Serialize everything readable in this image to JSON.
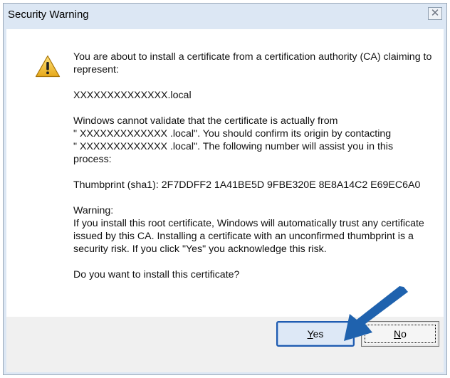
{
  "window": {
    "title": "Security Warning",
    "close_icon": "close-icon",
    "colors": {
      "titlebar": "#dce7f4",
      "content": "#ffffff",
      "footer": "#f0f0f0",
      "arrow": "#1f62ae"
    }
  },
  "message": {
    "icon": "warning-triangle-icon",
    "intro": "You are about to install a certificate from a certification authority (CA) claiming to represent:",
    "subject": "XXXXXXXXXXXXXX.local",
    "validation_line1": "Windows cannot validate that the certificate is actually from",
    "validation_line2": "\" XXXXXXXXXXXXX .local\". You should confirm its origin by contacting",
    "validation_line3": "\" XXXXXXXXXXXXX .local\". The following number will assist you in this",
    "validation_line4": "process:",
    "thumbprint": "Thumbprint (sha1): 2F7DDFF2 1A41BE5D 9FBE320E 8E8A14C2 E69EC6A0",
    "warning_heading": "Warning:",
    "warning_body": "If you install this root certificate, Windows will automatically trust any certificate issued by this CA. Installing a certificate with an unconfirmed thumbprint is a security risk. If you click \"Yes\" you acknowledge this risk.",
    "question": "Do you want to install this certificate?"
  },
  "buttons": {
    "yes_mnemonic": "Y",
    "yes_rest": "es",
    "no_mnemonic": "N",
    "no_rest": "o"
  },
  "annotation": {
    "icon": "pointer-arrow-icon"
  }
}
